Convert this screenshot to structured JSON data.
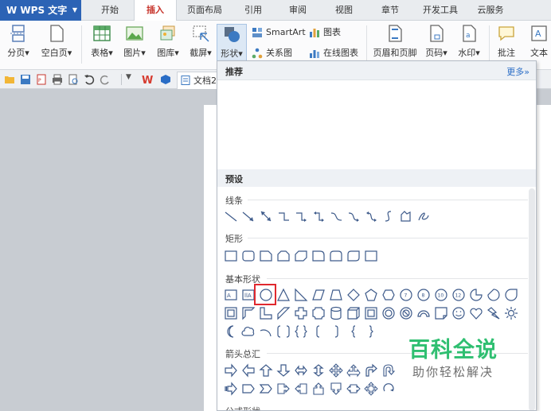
{
  "app": {
    "name": "WPS 文字"
  },
  "tabs": [
    "开始",
    "插入",
    "页面布局",
    "引用",
    "审阅",
    "视图",
    "章节",
    "开发工具",
    "云服务"
  ],
  "ribbon": {
    "page_break": "分页",
    "blank_page": "空白页",
    "table": "表格",
    "picture": "图片",
    "gallery": "图库",
    "screenshot": "截屏",
    "shapes": "形状",
    "smartart": "SmartArt",
    "chart": "图表",
    "relation_chart": "关系图",
    "online_chart": "在线图表",
    "header_footer": "页眉和页脚",
    "page_number": "页码",
    "watermark": "水印",
    "comment": "批注",
    "textbox": "文本"
  },
  "quickbar": {
    "doc_tab": "文档2"
  },
  "dropdown": {
    "recommended": "推荐",
    "more": "更多»",
    "preset": "预设",
    "categories": {
      "lines": "线条",
      "rectangles": "矩形",
      "basic_shapes": "基本形状",
      "block_arrows": "箭头总汇",
      "equation_shapes": "公式形状"
    }
  },
  "watermark": {
    "title": "百科全说",
    "subtitle": "助你轻松解决"
  },
  "colors": {
    "accent": "#2c63b5",
    "active_tab": "#c7342b",
    "selection": "#e0282e",
    "watermark": "#2fbf71"
  }
}
